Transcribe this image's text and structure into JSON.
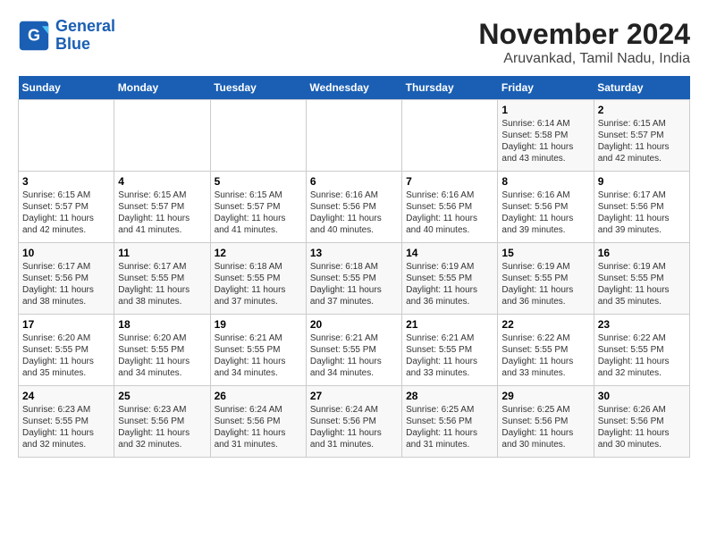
{
  "logo": {
    "line1": "General",
    "line2": "Blue"
  },
  "title": "November 2024",
  "subtitle": "Aruvankad, Tamil Nadu, India",
  "weekdays": [
    "Sunday",
    "Monday",
    "Tuesday",
    "Wednesday",
    "Thursday",
    "Friday",
    "Saturday"
  ],
  "weeks": [
    [
      {
        "day": "",
        "info": ""
      },
      {
        "day": "",
        "info": ""
      },
      {
        "day": "",
        "info": ""
      },
      {
        "day": "",
        "info": ""
      },
      {
        "day": "",
        "info": ""
      },
      {
        "day": "1",
        "info": "Sunrise: 6:14 AM\nSunset: 5:58 PM\nDaylight: 11 hours and 43 minutes."
      },
      {
        "day": "2",
        "info": "Sunrise: 6:15 AM\nSunset: 5:57 PM\nDaylight: 11 hours and 42 minutes."
      }
    ],
    [
      {
        "day": "3",
        "info": "Sunrise: 6:15 AM\nSunset: 5:57 PM\nDaylight: 11 hours and 42 minutes."
      },
      {
        "day": "4",
        "info": "Sunrise: 6:15 AM\nSunset: 5:57 PM\nDaylight: 11 hours and 41 minutes."
      },
      {
        "day": "5",
        "info": "Sunrise: 6:15 AM\nSunset: 5:57 PM\nDaylight: 11 hours and 41 minutes."
      },
      {
        "day": "6",
        "info": "Sunrise: 6:16 AM\nSunset: 5:56 PM\nDaylight: 11 hours and 40 minutes."
      },
      {
        "day": "7",
        "info": "Sunrise: 6:16 AM\nSunset: 5:56 PM\nDaylight: 11 hours and 40 minutes."
      },
      {
        "day": "8",
        "info": "Sunrise: 6:16 AM\nSunset: 5:56 PM\nDaylight: 11 hours and 39 minutes."
      },
      {
        "day": "9",
        "info": "Sunrise: 6:17 AM\nSunset: 5:56 PM\nDaylight: 11 hours and 39 minutes."
      }
    ],
    [
      {
        "day": "10",
        "info": "Sunrise: 6:17 AM\nSunset: 5:56 PM\nDaylight: 11 hours and 38 minutes."
      },
      {
        "day": "11",
        "info": "Sunrise: 6:17 AM\nSunset: 5:55 PM\nDaylight: 11 hours and 38 minutes."
      },
      {
        "day": "12",
        "info": "Sunrise: 6:18 AM\nSunset: 5:55 PM\nDaylight: 11 hours and 37 minutes."
      },
      {
        "day": "13",
        "info": "Sunrise: 6:18 AM\nSunset: 5:55 PM\nDaylight: 11 hours and 37 minutes."
      },
      {
        "day": "14",
        "info": "Sunrise: 6:19 AM\nSunset: 5:55 PM\nDaylight: 11 hours and 36 minutes."
      },
      {
        "day": "15",
        "info": "Sunrise: 6:19 AM\nSunset: 5:55 PM\nDaylight: 11 hours and 36 minutes."
      },
      {
        "day": "16",
        "info": "Sunrise: 6:19 AM\nSunset: 5:55 PM\nDaylight: 11 hours and 35 minutes."
      }
    ],
    [
      {
        "day": "17",
        "info": "Sunrise: 6:20 AM\nSunset: 5:55 PM\nDaylight: 11 hours and 35 minutes."
      },
      {
        "day": "18",
        "info": "Sunrise: 6:20 AM\nSunset: 5:55 PM\nDaylight: 11 hours and 34 minutes."
      },
      {
        "day": "19",
        "info": "Sunrise: 6:21 AM\nSunset: 5:55 PM\nDaylight: 11 hours and 34 minutes."
      },
      {
        "day": "20",
        "info": "Sunrise: 6:21 AM\nSunset: 5:55 PM\nDaylight: 11 hours and 34 minutes."
      },
      {
        "day": "21",
        "info": "Sunrise: 6:21 AM\nSunset: 5:55 PM\nDaylight: 11 hours and 33 minutes."
      },
      {
        "day": "22",
        "info": "Sunrise: 6:22 AM\nSunset: 5:55 PM\nDaylight: 11 hours and 33 minutes."
      },
      {
        "day": "23",
        "info": "Sunrise: 6:22 AM\nSunset: 5:55 PM\nDaylight: 11 hours and 32 minutes."
      }
    ],
    [
      {
        "day": "24",
        "info": "Sunrise: 6:23 AM\nSunset: 5:55 PM\nDaylight: 11 hours and 32 minutes."
      },
      {
        "day": "25",
        "info": "Sunrise: 6:23 AM\nSunset: 5:56 PM\nDaylight: 11 hours and 32 minutes."
      },
      {
        "day": "26",
        "info": "Sunrise: 6:24 AM\nSunset: 5:56 PM\nDaylight: 11 hours and 31 minutes."
      },
      {
        "day": "27",
        "info": "Sunrise: 6:24 AM\nSunset: 5:56 PM\nDaylight: 11 hours and 31 minutes."
      },
      {
        "day": "28",
        "info": "Sunrise: 6:25 AM\nSunset: 5:56 PM\nDaylight: 11 hours and 31 minutes."
      },
      {
        "day": "29",
        "info": "Sunrise: 6:25 AM\nSunset: 5:56 PM\nDaylight: 11 hours and 30 minutes."
      },
      {
        "day": "30",
        "info": "Sunrise: 6:26 AM\nSunset: 5:56 PM\nDaylight: 11 hours and 30 minutes."
      }
    ]
  ]
}
